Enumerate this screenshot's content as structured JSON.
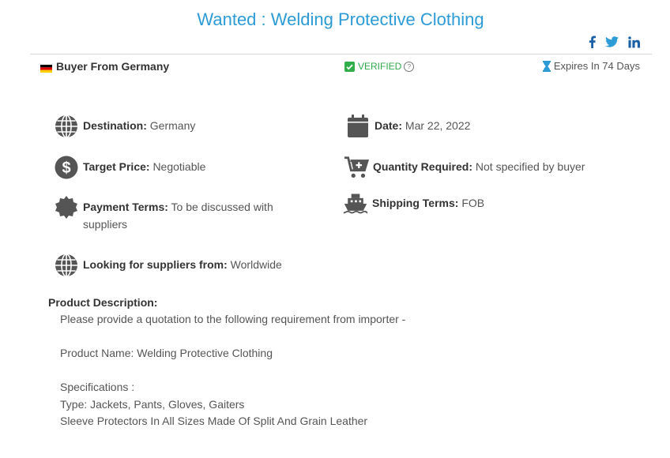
{
  "header": {
    "title": "Wanted : Welding Protective Clothing",
    "social_icons": [
      "facebook-icon",
      "twitter-icon",
      "linkedin-icon"
    ]
  },
  "buyer": {
    "label": "Buyer From Germany",
    "verified": "VERIFIED",
    "expires": "Expires In 74 Days"
  },
  "details": {
    "destination": {
      "label": "Destination:",
      "value": "Germany"
    },
    "date": {
      "label": "Date:",
      "value": "Mar 22, 2022"
    },
    "target_price": {
      "label": "Target Price:",
      "value": "Negotiable"
    },
    "quantity": {
      "label": "Quantity Required:",
      "value": "Not specified by buyer"
    },
    "payment": {
      "label": "Payment Terms:",
      "value": "To be discussed with suppliers"
    },
    "shipping": {
      "label": "Shipping Terms:",
      "value": "FOB"
    },
    "suppliers_from": {
      "label": "Looking for suppliers from:",
      "value": "Worldwide"
    }
  },
  "description": {
    "title": "Product Description:",
    "lines": [
      "Please provide a quotation to the following requirement from importer -",
      "",
      "Product Name: Welding Protective Clothing",
      "",
      "Specifications :",
      "Type: Jackets, Pants, Gloves, Gaiters",
      "Sleeve Protectors In All Sizes Made Of Split And Grain Leather"
    ]
  },
  "colors": {
    "title": "#2d9bd6",
    "verified": "#33a84b",
    "social": "#1b5fa7",
    "icons": "#555555"
  }
}
